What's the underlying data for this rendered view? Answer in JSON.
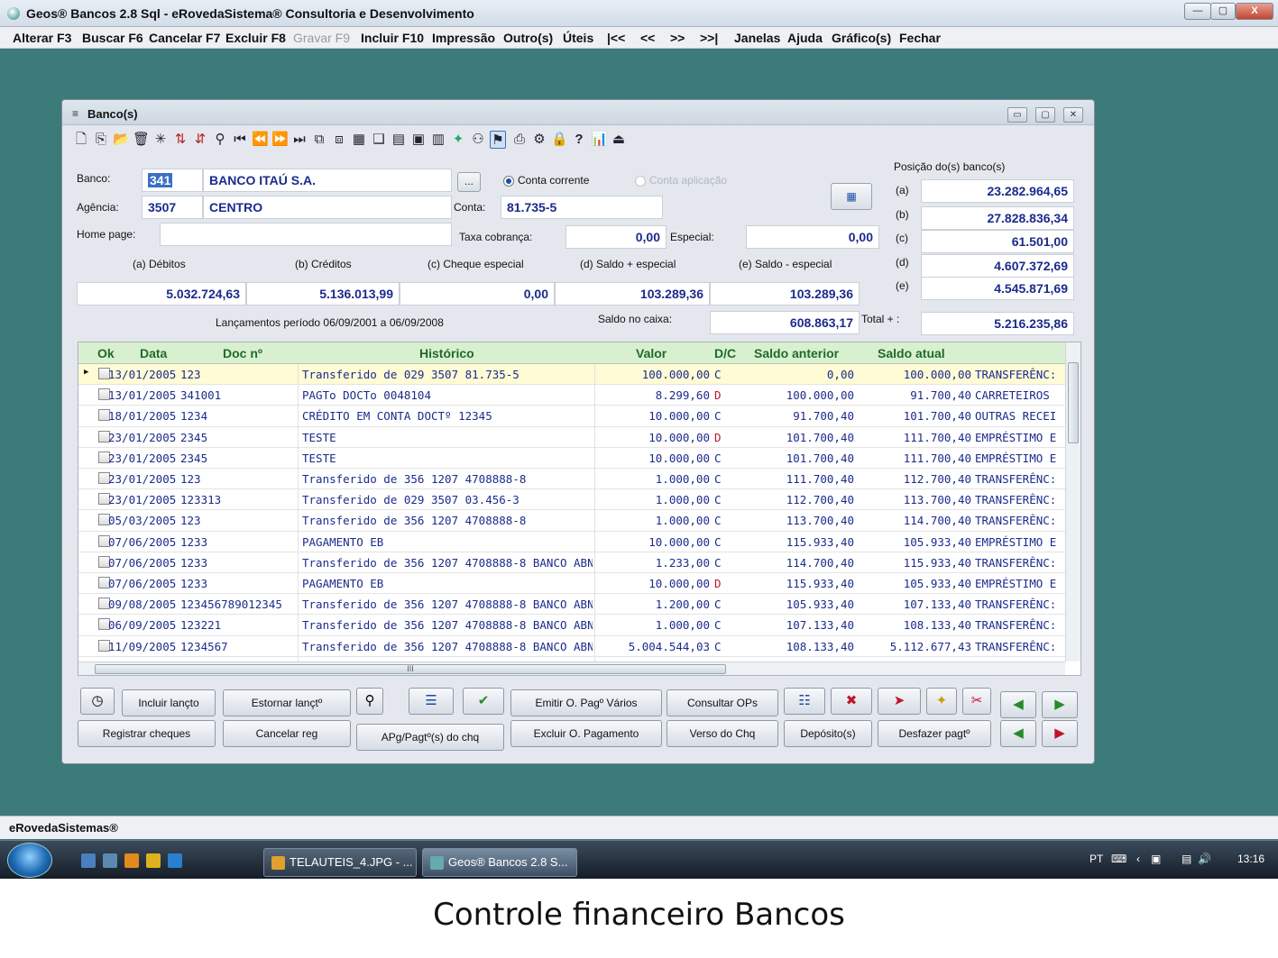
{
  "window": {
    "title": "Geos® Bancos 2.8 Sql - eRovedaSistema® Consultoria e Desenvolvimento",
    "controls": [
      "—",
      "▢",
      "X"
    ]
  },
  "menu": [
    {
      "label": "Alterar F3",
      "enabled": true
    },
    {
      "label": "Buscar F6",
      "enabled": true
    },
    {
      "label": "Cancelar F7",
      "enabled": true
    },
    {
      "label": "Excluir F8",
      "enabled": true
    },
    {
      "label": "Gravar F9",
      "enabled": false
    },
    {
      "label": "Incluir F10",
      "enabled": true
    },
    {
      "label": "Impressão",
      "enabled": true
    },
    {
      "label": "Outro(s)",
      "enabled": true
    },
    {
      "label": "Úteis",
      "enabled": true
    },
    {
      "label": "|<<",
      "enabled": true
    },
    {
      "label": "<<",
      "enabled": true
    },
    {
      "label": ">>",
      "enabled": true
    },
    {
      "label": ">>|",
      "enabled": true
    },
    {
      "label": "Janelas",
      "enabled": true
    },
    {
      "label": "Ajuda",
      "enabled": true
    },
    {
      "label": "Gráfico(s)",
      "enabled": true
    },
    {
      "label": "Fechar",
      "enabled": true
    }
  ],
  "child": {
    "title": "Banco(s)",
    "controls": [
      "▭",
      "▢",
      "✕"
    ]
  },
  "form": {
    "banco_label": "Banco:",
    "banco_code": "341",
    "banco_name": "BANCO ITAÚ S.A.",
    "browse_label": "...",
    "conta_corrente": "Conta corrente",
    "conta_aplicacao": "Conta aplicação",
    "agencia_label": "Agência:",
    "agencia_code": "3507",
    "agencia_name": "CENTRO",
    "conta_label": "Conta:",
    "conta_value": "81.735-5",
    "homepage_label": "Home page:",
    "homepage_value": "",
    "taxa_label": "Taxa cobrança:",
    "taxa_value": "0,00",
    "especial_label": "Especial:",
    "especial_value": "0,00",
    "totals": {
      "debitos_label": "(a) Débitos",
      "debitos_value": "5.032.724,63",
      "creditos_label": "(b) Créditos",
      "creditos_value": "5.136.013,99",
      "cheque_label": "(c) Cheque especial",
      "cheque_value": "0,00",
      "saldo_esp_label": "(d) Saldo + especial",
      "saldo_esp_value": "103.289,36",
      "saldo_menos_label": "(e) Saldo - especial",
      "saldo_menos_value": "103.289,36"
    },
    "periodo_text": "Lançamentos período 06/09/2001 a 06/09/2008",
    "saldo_caixa_label": "Saldo no caixa:",
    "saldo_caixa_value": "608.863,17",
    "total_label": "Total + :",
    "total_value": "5.216.235,86",
    "posicao": {
      "title": "Posição do(s) banco(s)",
      "items": [
        {
          "label": "(a)",
          "value": "23.282.964,65"
        },
        {
          "label": "(b)",
          "value": "27.828.836,34"
        },
        {
          "label": "(c)",
          "value": "61.501,00"
        },
        {
          "label": "(d)",
          "value": "4.607.372,69"
        },
        {
          "label": "(e)",
          "value": "4.545.871,69"
        }
      ]
    }
  },
  "grid": {
    "headers": [
      "Ok",
      "Data",
      "Doc nº",
      "Histórico",
      "Valor",
      "D/C",
      "Saldo anterior",
      "Saldo atual"
    ],
    "rows": [
      {
        "data": "13/01/2005",
        "doc": "123",
        "hist": "Transferido de 029 3507 81.735-5",
        "valor": "100.000,00",
        "dc": "C",
        "saldo_ant": "0,00",
        "saldo_at": "100.000,00",
        "extra": "TRANSFERÊNC:"
      },
      {
        "data": "13/01/2005",
        "doc": "341001",
        "hist": "PAGTo DOCTo 0048104",
        "valor": "8.299,60",
        "dc": "D",
        "saldo_ant": "100.000,00",
        "saldo_at": "91.700,40",
        "extra": "CARRETEIROS"
      },
      {
        "data": "18/01/2005",
        "doc": "1234",
        "hist": "CRÉDITO EM CONTA DOCTº 12345",
        "valor": "10.000,00",
        "dc": "C",
        "saldo_ant": "91.700,40",
        "saldo_at": "101.700,40",
        "extra": "OUTRAS RECEI"
      },
      {
        "data": "23/01/2005",
        "doc": "2345",
        "hist": "TESTE",
        "valor": "10.000,00",
        "dc": "D",
        "saldo_ant": "101.700,40",
        "saldo_at": "111.700,40",
        "extra": "EMPRÉSTIMO E"
      },
      {
        "data": "23/01/2005",
        "doc": "2345",
        "hist": "TESTE",
        "valor": "10.000,00",
        "dc": "C",
        "saldo_ant": "101.700,40",
        "saldo_at": "111.700,40",
        "extra": "EMPRÉSTIMO E"
      },
      {
        "data": "23/01/2005",
        "doc": "123",
        "hist": "Transferido de 356 1207 4708888-8",
        "valor": "1.000,00",
        "dc": "C",
        "saldo_ant": "111.700,40",
        "saldo_at": "112.700,40",
        "extra": "TRANSFERÊNC:"
      },
      {
        "data": "23/01/2005",
        "doc": "123313",
        "hist": "Transferido de 029 3507 03.456-3",
        "valor": "1.000,00",
        "dc": "C",
        "saldo_ant": "112.700,40",
        "saldo_at": "113.700,40",
        "extra": "TRANSFERÊNC:"
      },
      {
        "data": "05/03/2005",
        "doc": "123",
        "hist": "Transferido de 356 1207 4708888-8",
        "valor": "1.000,00",
        "dc": "C",
        "saldo_ant": "113.700,40",
        "saldo_at": "114.700,40",
        "extra": "TRANSFERÊNC:"
      },
      {
        "data": "07/06/2005",
        "doc": "1233",
        "hist": "PAGAMENTO EB",
        "valor": "10.000,00",
        "dc": "C",
        "saldo_ant": "115.933,40",
        "saldo_at": "105.933,40",
        "extra": "EMPRÉSTIMO E"
      },
      {
        "data": "07/06/2005",
        "doc": "1233",
        "hist": "Transferido de 356 1207 4708888-8 BANCO ABN A",
        "valor": "1.233,00",
        "dc": "C",
        "saldo_ant": "114.700,40",
        "saldo_at": "115.933,40",
        "extra": "TRANSFERÊNC:"
      },
      {
        "data": "07/06/2005",
        "doc": "1233",
        "hist": "PAGAMENTO EB",
        "valor": "10.000,00",
        "dc": "D",
        "saldo_ant": "115.933,40",
        "saldo_at": "105.933,40",
        "extra": "EMPRÉSTIMO E"
      },
      {
        "data": "09/08/2005",
        "doc": "123456789012345",
        "hist": "Transferido de 356 1207 4708888-8 BANCO ABN A",
        "valor": "1.200,00",
        "dc": "C",
        "saldo_ant": "105.933,40",
        "saldo_at": "107.133,40",
        "extra": "TRANSFERÊNC:"
      },
      {
        "data": "06/09/2005",
        "doc": "123221",
        "hist": "Transferido de 356 1207 4708888-8 BANCO ABN A",
        "valor": "1.000,00",
        "dc": "C",
        "saldo_ant": "107.133,40",
        "saldo_at": "108.133,40",
        "extra": "TRANSFERÊNC:"
      },
      {
        "data": "11/09/2005",
        "doc": "1234567",
        "hist": "Transferido de 356 1207 4708888-8 BANCO ABN A",
        "valor": "5.004.544,03",
        "dc": "C",
        "saldo_ant": "108.133,40",
        "saldo_at": "5.112.677,43",
        "extra": "TRANSFERÊNC:"
      }
    ],
    "hscroll_mark": "III"
  },
  "buttons": {
    "incluir": "Incluir lançto",
    "estornar": "Estornar lançtº",
    "emitir": "Emitir O. Pagº Vários",
    "consultar": "Consultar OPs",
    "registrar": "Registrar cheques",
    "cancelar_reg": "Cancelar reg",
    "apg": "APg/Pagtº(s) do chq",
    "excluir_op": "Excluir O. Pagamento",
    "verso": "Verso do Chq",
    "deposito": "Depósito(s)",
    "desfazer": "Desfazer pagtº"
  },
  "status": "eRovedaSistemas®",
  "taskbar": {
    "tasks": [
      "TELAUTEIS_4.JPG - ...",
      "Geos® Bancos 2.8 S..."
    ],
    "lang": "PT",
    "clock": "13:16"
  },
  "caption": "Controle financeiro Bancos",
  "colors": {
    "desktop": "#3d7a7a",
    "value_blue": "#1b2b8c",
    "grid_header_green": "#1f6b2a",
    "debit_red": "#c0142a"
  }
}
